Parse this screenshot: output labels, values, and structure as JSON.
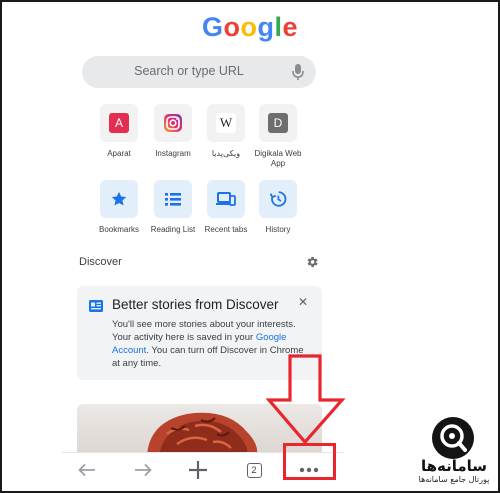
{
  "logo": {
    "letters": [
      "G",
      "o",
      "o",
      "g",
      "l",
      "e"
    ],
    "colors": [
      "#4285f4",
      "#ea4335",
      "#fbbc05",
      "#4285f4",
      "#34a853",
      "#ea4335"
    ]
  },
  "search": {
    "placeholder": "Search or type URL",
    "mic_icon": "microphone-icon"
  },
  "shortcuts": [
    {
      "label": "Aparat",
      "icon_text": "A",
      "color": "#e32e52"
    },
    {
      "label": "Instagram",
      "icon": "instagram-icon"
    },
    {
      "label": "ویکی‌پدیا",
      "icon_text": "W"
    },
    {
      "label": "Digikala Web App",
      "icon_text": "D",
      "color": "#6e6e6e"
    }
  ],
  "quick_actions": [
    {
      "label": "Bookmarks",
      "icon": "star-icon"
    },
    {
      "label": "Reading List",
      "icon": "list-icon"
    },
    {
      "label": "Recent tabs",
      "icon": "devices-icon"
    },
    {
      "label": "History",
      "icon": "history-icon"
    }
  ],
  "discover": {
    "label": "Discover",
    "card_title": "Better stories from Discover",
    "card_body_1": "You'll see more stories about your interests. Your activity here is saved in your ",
    "card_link": "Google Account",
    "card_body_2": ". You can turn off Discover in Chrome at any time.",
    "close_glyph": "✕"
  },
  "toolbar": {
    "tab_count": "2",
    "new_tab_glyph": "+"
  },
  "watermark": {
    "title": "سامانه‌ها",
    "subtitle": "پورتال جامع سامانه‌ها"
  },
  "accent": {
    "annotation_red": "#e8262d",
    "link_blue": "#1a73e8"
  }
}
